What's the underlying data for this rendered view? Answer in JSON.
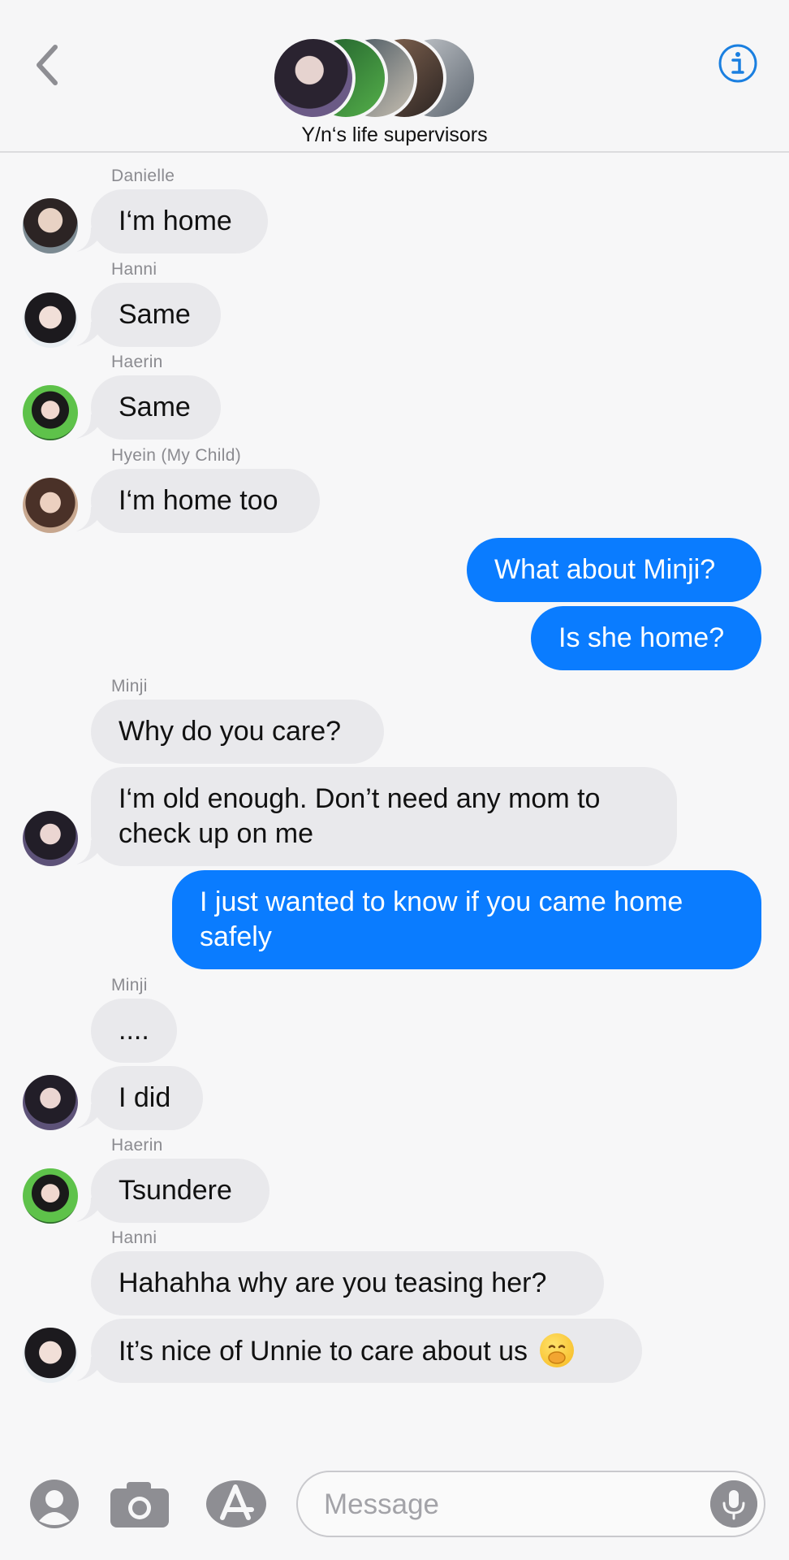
{
  "header": {
    "title": "Y/n‘s life supervisors",
    "back_icon": "chevron-left-icon",
    "info_icon": "info-icon",
    "accent": "#1a7fe0"
  },
  "messages": [
    {
      "sender": "Danielle",
      "text": "I‘m home"
    },
    {
      "sender": "Hanni",
      "text": "Same"
    },
    {
      "sender": "Haerin",
      "text": "Same"
    },
    {
      "sender": "Hyein (My Child)",
      "text": "I‘m home too"
    },
    {
      "out1": "What about Minji?"
    },
    {
      "out2": "Is she home?"
    },
    {
      "sender": "Minji",
      "text1": "Why do you care?",
      "text2_line1": "I‘m old enough. Don’t need any mom to",
      "text2_line2": "check up on me"
    },
    {
      "out_line1": "I just wanted to know if you came home",
      "out_line2": "safely"
    },
    {
      "sender": "Minji",
      "text1": "....",
      "text2": "I did"
    },
    {
      "sender": "Haerin",
      "text": "Tsundere"
    },
    {
      "sender": "Hanni",
      "text1": "Hahahha why are you teasing her?",
      "text2": "It’s nice of Unnie to care about us"
    }
  ],
  "composer": {
    "placeholder": "Message",
    "icons": [
      "contact-icon",
      "camera-icon",
      "app-store-icon",
      "microphone-icon"
    ]
  },
  "colors": {
    "incoming_bubble": "#e9e9ec",
    "outgoing_bubble": "#0a7cff",
    "background": "#f7f7f8"
  }
}
